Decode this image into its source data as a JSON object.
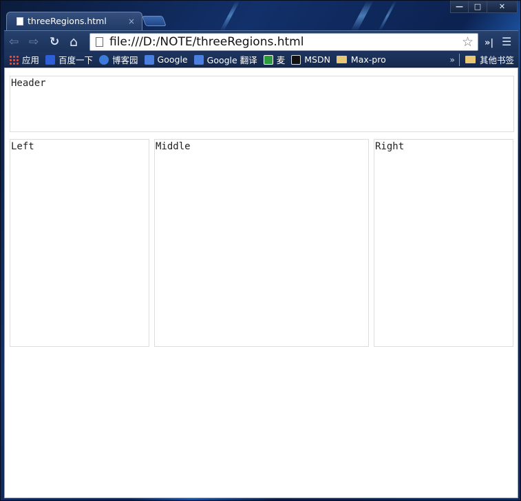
{
  "tab": {
    "title": "threeRegions.html",
    "close": "×"
  },
  "caption": {
    "minimize": "—",
    "maximize": "□",
    "close": "✕"
  },
  "toolbar": {
    "back_icon": "⇦",
    "forward_icon": "⇨",
    "reload_icon": "↻",
    "home_icon": "⌂",
    "url": "file:///D:/NOTE/threeRegions.html",
    "star_icon": "☆",
    "extension_icon": "»|",
    "menu_icon": "☰"
  },
  "bookmarks": {
    "items": [
      {
        "label": "应用",
        "icon": "apps-grid-icon",
        "color": "#e74c3c"
      },
      {
        "label": "百度一下",
        "icon": "baidu-paw-icon",
        "color": "#2f5fd8"
      },
      {
        "label": "博客园",
        "icon": "cnblogs-icon",
        "color": "#3e7bd9"
      },
      {
        "label": "Google",
        "icon": "google-icon",
        "color": "#4a7fe0"
      },
      {
        "label": "Google 翻译",
        "icon": "translate-icon",
        "color": "#4a7fe0"
      },
      {
        "label": "麦",
        "icon": "green-square-icon",
        "color": "#2e9a3e"
      },
      {
        "label": "MSDN",
        "icon": "msdn-m-icon",
        "color": "#111111"
      },
      {
        "label": "Max-pro",
        "icon": "folder-icon",
        "color": "#e8c874"
      }
    ],
    "overflow": "»",
    "other": "其他书签"
  },
  "page": {
    "header": "Header",
    "left": "Left",
    "middle": "Middle",
    "right": "Right"
  }
}
